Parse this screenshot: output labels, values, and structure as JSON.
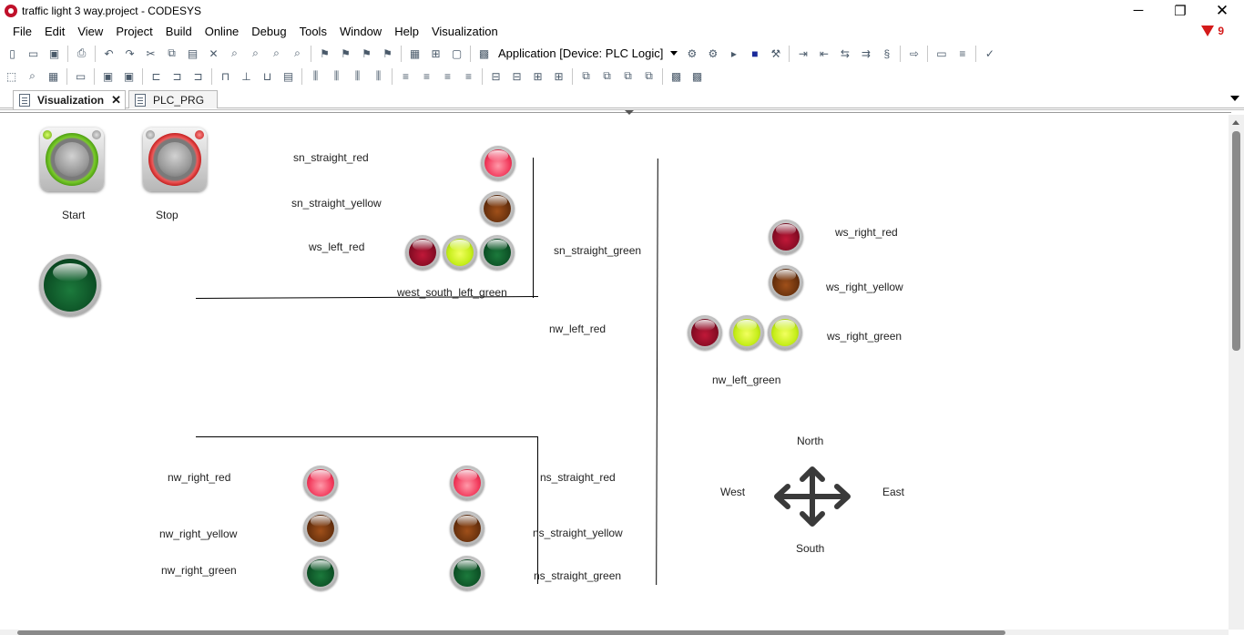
{
  "window": {
    "title": "traffic light 3 way.project - CODESYS",
    "minimize": "─",
    "maximize": "❐",
    "close": "✕"
  },
  "menu": [
    "File",
    "Edit",
    "View",
    "Project",
    "Build",
    "Online",
    "Debug",
    "Tools",
    "Window",
    "Help",
    "Visualization"
  ],
  "messages": {
    "count": "9",
    "color": "#d41a1a"
  },
  "toolbar": {
    "application_combo": "Application [Device: PLC Logic]"
  },
  "tabs": [
    {
      "label": "Visualization",
      "active": true,
      "close": "✕"
    },
    {
      "label": "PLC_PRG",
      "active": false
    }
  ],
  "visualization": {
    "buttons": {
      "start": "Start",
      "stop": "Stop"
    },
    "labels": {
      "sn_straight_red": "sn_straight_red",
      "sn_straight_yellow": "sn_straight_yellow",
      "ws_left_red": "ws_left_red",
      "sn_straight_green": "sn_straight_green",
      "west_south_left_green": "west_south_left_green",
      "nw_left_red": "nw_left_red",
      "ws_right_red": "ws_right_red",
      "ws_right_yellow": "ws_right_yellow",
      "ws_right_green": "ws_right_green",
      "nw_left_green": "nw_left_green",
      "nw_right_red": "nw_right_red",
      "nw_right_yellow": "nw_right_yellow",
      "nw_right_green": "nw_right_green",
      "ns_straight_red": "ns_straight_red",
      "ns_straight_yellow": "ns_straight_yellow",
      "ns_straight_green": "ns_straight_green"
    },
    "compass": {
      "north": "North",
      "south": "South",
      "east": "East",
      "west": "West"
    },
    "colors": {
      "red_on": "#f23a5c",
      "red_off": "#7a0a20",
      "yellow_off": "#5c2a0a",
      "green_on": "#c6ee1a",
      "green_off": "#0a4a22"
    }
  }
}
